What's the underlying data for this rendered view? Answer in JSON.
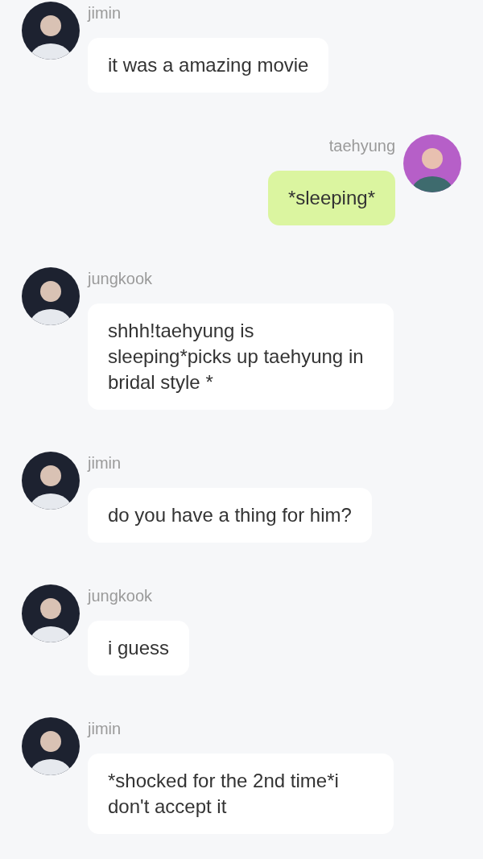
{
  "messages": [
    {
      "kind": "received",
      "sender": "jimin",
      "text": "it was a amazing movie"
    },
    {
      "kind": "sent",
      "sender": "taehyung",
      "text": "*sleeping*"
    },
    {
      "kind": "received",
      "sender": "jungkook",
      "text": "shhh!taehyung is sleeping*picks up taehyung in bridal style *"
    },
    {
      "kind": "received",
      "sender": "jimin",
      "text": "do you have a thing for him?"
    },
    {
      "kind": "received",
      "sender": "jungkook",
      "text": "i guess"
    },
    {
      "kind": "received",
      "sender": "jimin",
      "text": "*shocked for the 2nd time*i don't accept it"
    }
  ]
}
